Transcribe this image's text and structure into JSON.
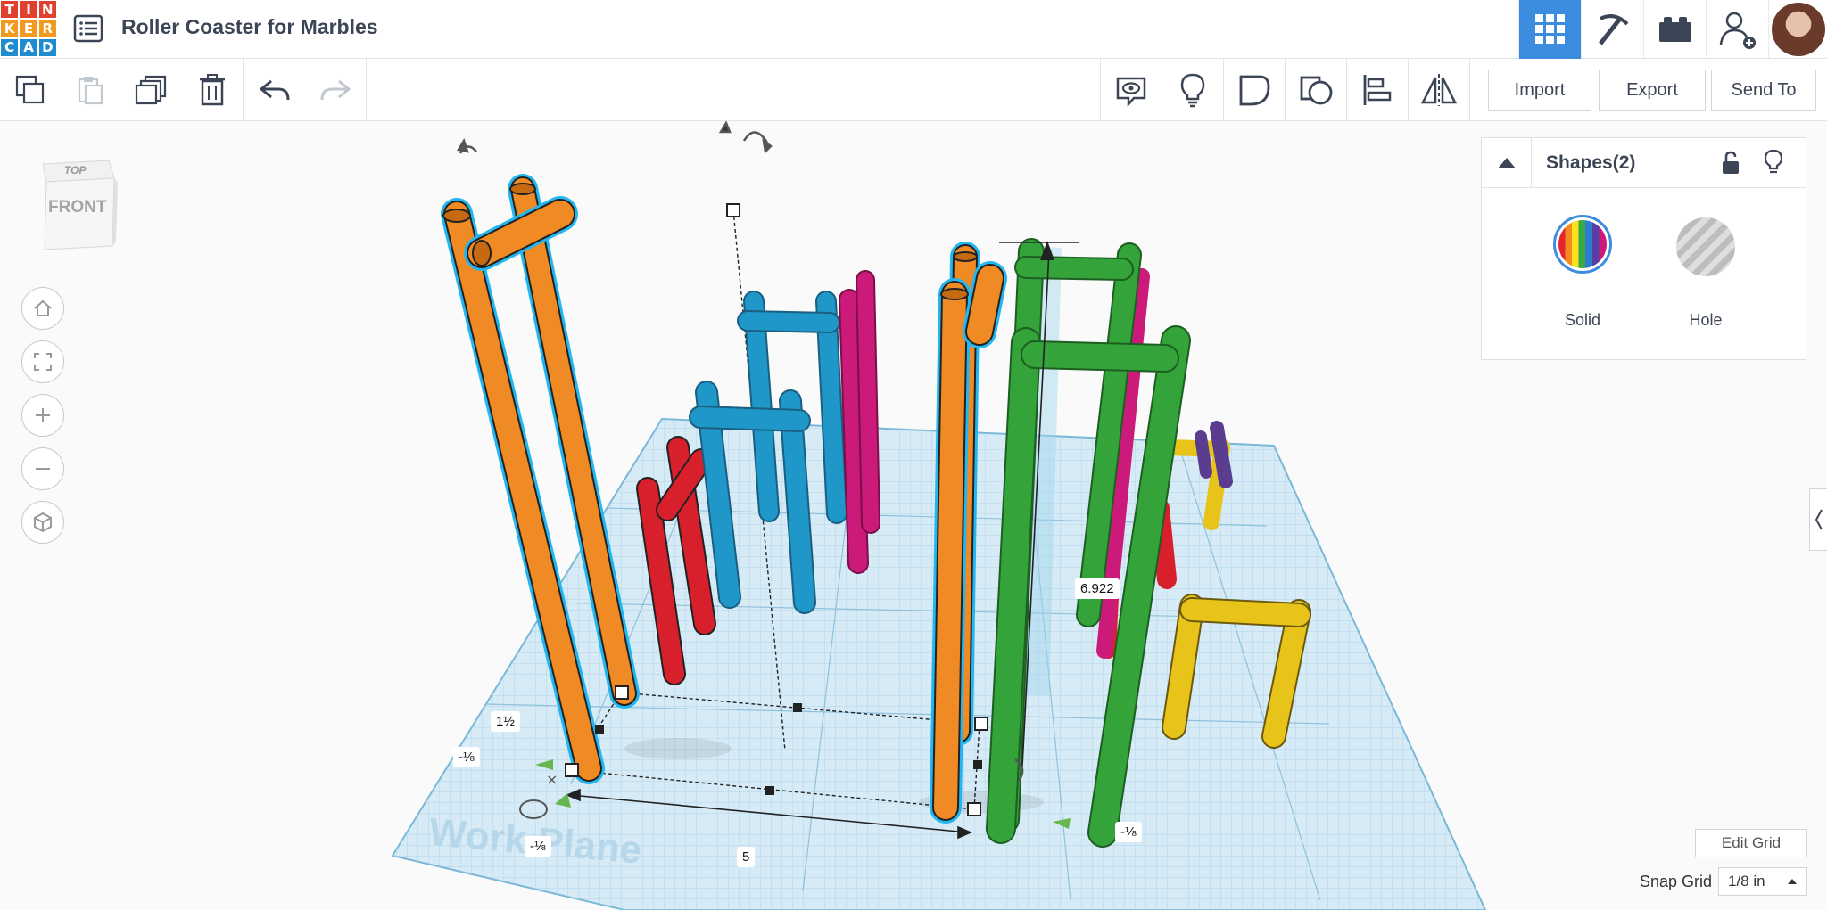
{
  "app": {
    "logo_letters": [
      "T",
      "I",
      "N",
      "K",
      "E",
      "R",
      "C",
      "A",
      "D"
    ],
    "logo_colors": [
      "#e2402e",
      "#e2402e",
      "#e2402e",
      "#f29a1f",
      "#f29a1f",
      "#f29a1f",
      "#1f8ccf",
      "#1f8ccf",
      "#1f8ccf"
    ],
    "project_title": "Roller Coaster for Marbles"
  },
  "header": {
    "icons": [
      "grid-view-icon",
      "pickaxe-icon",
      "bricks-icon",
      "add-user-icon"
    ],
    "accent": "#3c8de0"
  },
  "toolbar": {
    "left_icons": [
      "copy-icon",
      "paste-icon",
      "duplicate-icon",
      "delete-icon",
      "undo-icon",
      "redo-icon"
    ],
    "right_icons": [
      "notes-icon",
      "light-icon",
      "shape-group-icon",
      "shape-ungroup-icon",
      "align-icon",
      "mirror-icon"
    ],
    "import_label": "Import",
    "export_label": "Export",
    "send_to_label": "Send To"
  },
  "viewcube": {
    "top_label": "TOP",
    "front_label": "FRONT"
  },
  "nav": [
    "home-view-icon",
    "fit-view-icon",
    "zoom-in-icon",
    "zoom-out-icon",
    "perspective-icon"
  ],
  "panel": {
    "title": "Shapes(2)",
    "solid_label": "Solid",
    "hole_label": "Hole"
  },
  "workplane": {
    "label": "Work Plane"
  },
  "dimensions": {
    "height": "6.922",
    "width": "5",
    "depth": "1½",
    "offset_a": "-⅛",
    "offset_b": "-⅛",
    "offset_c": "-⅛"
  },
  "grid": {
    "edit_label": "Edit Grid",
    "snap_label": "Snap Grid",
    "snap_value": "1/8 in"
  },
  "colors": {
    "orange": "#f08a24",
    "blue": "#1f97c9",
    "magenta": "#cc1a7a",
    "red": "#d8202c",
    "green": "#33a33a",
    "yellow": "#e8c41a",
    "purple": "#5b3d8f",
    "plane": "#cfe6f3",
    "selection": "#23b6f0"
  }
}
